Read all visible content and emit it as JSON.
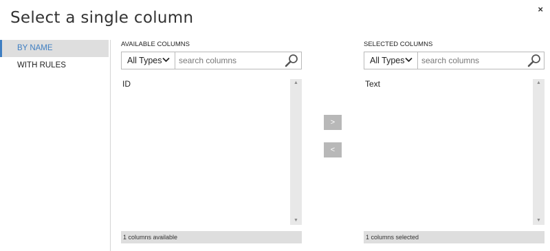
{
  "dialog": {
    "title": "Select a single column",
    "close_label": "×"
  },
  "sidebar": {
    "items": [
      {
        "label": "BY NAME",
        "active": true
      },
      {
        "label": "WITH RULES",
        "active": false
      }
    ]
  },
  "available": {
    "header": "AVAILABLE COLUMNS",
    "type_filter": "All Types",
    "search_placeholder": "search columns",
    "items": [
      "ID"
    ],
    "status": "1 columns available"
  },
  "selected": {
    "header": "SELECTED COLUMNS",
    "type_filter": "All Types",
    "search_placeholder": "search columns",
    "items": [
      "Text"
    ],
    "status": "1 columns selected"
  },
  "buttons": {
    "add_label": ">",
    "remove_label": "<"
  },
  "colors": {
    "accent": "#3e7ec2",
    "button_gray": "#b8b8b8",
    "panel_gray": "#dedede"
  }
}
